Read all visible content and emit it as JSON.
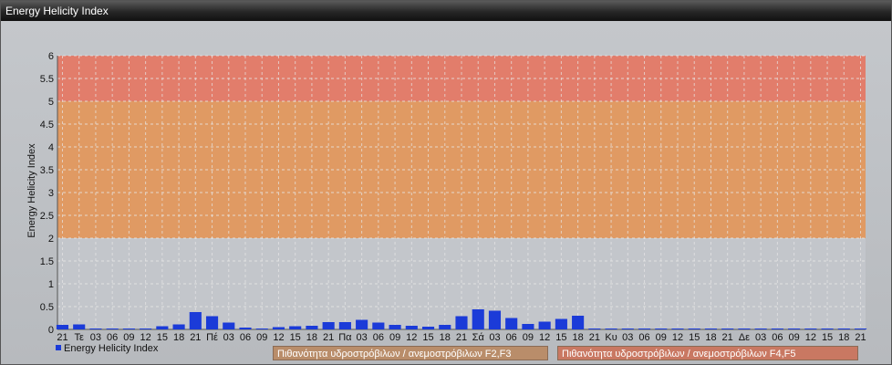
{
  "window": {
    "title": "Energy Helicity Index"
  },
  "colors": {
    "bar": "#1b3bd8",
    "zone_orange": "#e09a63",
    "zone_red": "#e27d6b"
  },
  "legend": {
    "series_label": "Energy Helicity Index",
    "zone1_label": "Πιθανότητα υδροστρόβιλων / ανεμοστρόβιλων F2,F3",
    "zone2_label": "Πιθανότητα υδροστρόβιλων / ανεμοστρόβιλων F4,F5"
  },
  "chart_data": {
    "type": "bar",
    "ylabel": "Energy Helicity Index",
    "ylim": [
      0,
      6
    ],
    "yticks": [
      "0",
      "0.5",
      "1",
      "1.5",
      "2",
      "2.5",
      "3",
      "3.5",
      "4",
      "4.5",
      "5",
      "5.5",
      "6"
    ],
    "bands": [
      {
        "from": 2,
        "to": 5,
        "label": "Πιθανότητα υδροστρόβιλων / ανεμοστρόβιλων F2,F3"
      },
      {
        "from": 5,
        "to": 6,
        "label": "Πιθανότητα υδροστρόβιλων / ανεμοστρόβιλων F4,F5"
      }
    ],
    "categories": [
      "21",
      "Τε",
      "03",
      "06",
      "09",
      "12",
      "15",
      "18",
      "21",
      "Πέ",
      "03",
      "06",
      "09",
      "12",
      "15",
      "18",
      "21",
      "Πα",
      "03",
      "06",
      "09",
      "12",
      "15",
      "18",
      "21",
      "Σά",
      "03",
      "06",
      "09",
      "12",
      "15",
      "18",
      "21",
      "Κυ",
      "03",
      "06",
      "09",
      "12",
      "15",
      "18",
      "21",
      "Δε",
      "03",
      "06",
      "09",
      "12",
      "15",
      "18",
      "21"
    ],
    "series": [
      {
        "name": "Energy Helicity Index",
        "values": [
          0.1,
          0.11,
          0.02,
          0.02,
          0.02,
          0.02,
          0.07,
          0.11,
          0.38,
          0.29,
          0.15,
          0.04,
          0.02,
          0.05,
          0.07,
          0.08,
          0.16,
          0.16,
          0.21,
          0.15,
          0.1,
          0.08,
          0.06,
          0.1,
          0.29,
          0.44,
          0.41,
          0.25,
          0.12,
          0.17,
          0.23,
          0.3,
          0.02,
          0.02,
          0.02,
          0.02,
          0.02,
          0.02,
          0.02,
          0.02,
          0.02,
          0.02,
          0.02,
          0.02,
          0.02,
          0.02,
          0.02,
          0.02,
          0.02
        ]
      }
    ],
    "grid": true,
    "legend_position": "bottom"
  }
}
